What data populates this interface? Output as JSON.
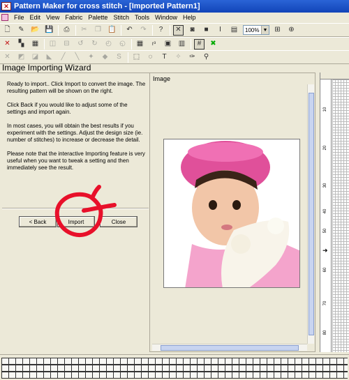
{
  "window": {
    "title": "Pattern Maker for cross stitch - [Imported Pattern1]"
  },
  "menu": [
    "File",
    "Edit",
    "View",
    "Fabric",
    "Palette",
    "Stitch",
    "Tools",
    "Window",
    "Help"
  ],
  "toolbar": {
    "zoom_value": "100%"
  },
  "wizard": {
    "title": "Image Importing Wizard",
    "paragraphs": [
      "Ready to import.. Click Import to convert the image. The resulting pattern will be shown on the right.",
      "Click Back if you would like to adjust some of the settings and import again.",
      "In most cases, you will obtain the best results if you experiment with the settings. Adjust the design size (ie. number of stitches) to increase or decrease the detail.",
      "Please note that the interactive Importing feature is very useful when you want to tweak a setting and then immediately see the result."
    ],
    "back_label": "< Back",
    "import_label": "Import",
    "close_label": "Close"
  },
  "image_panel": {
    "label": "Image"
  },
  "preview": {
    "ruler_numbers": [
      "10",
      "20",
      "30",
      "40",
      "50",
      "60",
      "70",
      "80"
    ]
  },
  "colors": {
    "titlebar": "#1f55c8",
    "annotation": "#e8102a",
    "hat": "#e0509a"
  }
}
